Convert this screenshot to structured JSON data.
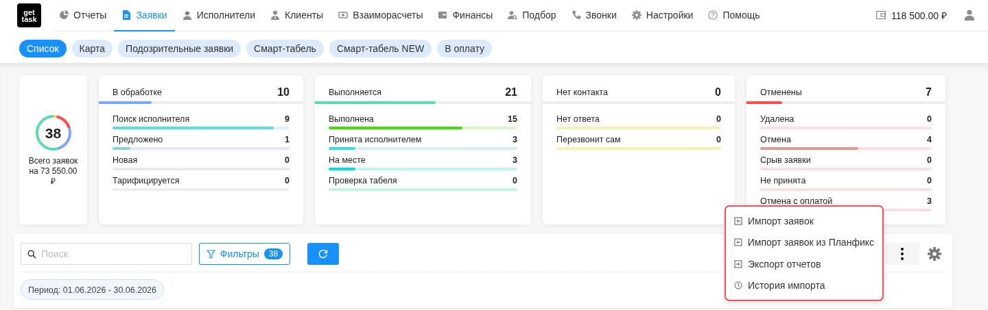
{
  "logo": {
    "top": "get",
    "bottom": "task"
  },
  "nav": [
    {
      "label": "Отчеты",
      "selected": false
    },
    {
      "label": "Заявки",
      "selected": true
    },
    {
      "label": "Исполнители",
      "selected": false
    },
    {
      "label": "Клиенты",
      "selected": false
    },
    {
      "label": "Взаиморасчеты",
      "selected": false
    },
    {
      "label": "Финансы",
      "selected": false
    },
    {
      "label": "Подбор",
      "selected": false
    },
    {
      "label": "Звонки",
      "selected": false
    },
    {
      "label": "Настройки",
      "selected": false
    },
    {
      "label": "Помощь",
      "selected": false
    }
  ],
  "balance": "118 500.00 ₽",
  "subtabs": [
    {
      "label": "Список",
      "selected": true
    },
    {
      "label": "Карта",
      "selected": false
    },
    {
      "label": "Подозрительные заявки",
      "selected": false
    },
    {
      "label": "Смарт-табель",
      "selected": false
    },
    {
      "label": "Смарт-табель NEW",
      "selected": false
    },
    {
      "label": "В оплату",
      "selected": false
    }
  ],
  "total": {
    "count": "38",
    "caption": "Всего заявок на 73 550.00 ₽"
  },
  "groups": [
    {
      "title": "В обработке",
      "count": "10",
      "level": 0.26,
      "color": "#7ba7ff",
      "rows": [
        {
          "label": "Поиск исполнителя",
          "count": "9",
          "level": 0.91,
          "color": "#dcf1fc"
        },
        {
          "label": "Предложено",
          "count": "1",
          "level": 0.1,
          "color": "#dde8fb"
        },
        {
          "label": "Новая",
          "count": "0",
          "color": "#e6e8f8"
        },
        {
          "label": "Тарифицируется",
          "count": "0",
          "color": "#eeeeee"
        }
      ]
    },
    {
      "title": "Выполняется",
      "count": "21",
      "level": 0.56,
      "color": "#5ddbb0",
      "rows": [
        {
          "label": "Выполнена",
          "count": "15",
          "level": 0.71,
          "color": "#d8f7c8"
        },
        {
          "label": "Принята исполнителем",
          "count": "3",
          "level": 0.14,
          "color": "#d5f0f5"
        },
        {
          "label": "На месте",
          "count": "3",
          "level": 0.14,
          "color": "#c0f5ef"
        },
        {
          "label": "Проверка табеля",
          "count": "0",
          "color": "#c8f5e0"
        }
      ]
    },
    {
      "title": "Нет контакта",
      "count": "0",
      "color": "#ffd54a",
      "rows": [
        {
          "label": "Нет ответа",
          "count": "0",
          "color": "#fdecb5"
        },
        {
          "label": "Перезвонит сам",
          "count": "0",
          "color": "#fdecb5"
        }
      ]
    },
    {
      "title": "Отменены",
      "count": "7",
      "level": 0.18,
      "color": "#ff4d4f",
      "rows": [
        {
          "label": "Удалена",
          "count": "0",
          "color": "#ffdede"
        },
        {
          "label": "Отмена",
          "count": "4",
          "level": 0.57,
          "color": "#ffdede"
        },
        {
          "label": "Срыв заявки",
          "count": "0",
          "color": "#ffdede"
        },
        {
          "label": "Не принята",
          "count": "0",
          "color": "#ffdede"
        },
        {
          "label": "Отмена с оплатой",
          "count": "3",
          "color": "#ffdede"
        }
      ]
    }
  ],
  "toolbar": {
    "search": {
      "placeholder": "Поиск"
    },
    "filters": {
      "label": "Фильтры",
      "badge": "38"
    },
    "period": "Период: 01.06.2026 - 30.06.2026"
  },
  "menu": {
    "items": [
      {
        "label": "Импорт заявок"
      },
      {
        "label": "Импорт заявок из Планфикс"
      },
      {
        "label": "Экспорт отчетов"
      },
      {
        "label": "История импорта"
      }
    ]
  }
}
